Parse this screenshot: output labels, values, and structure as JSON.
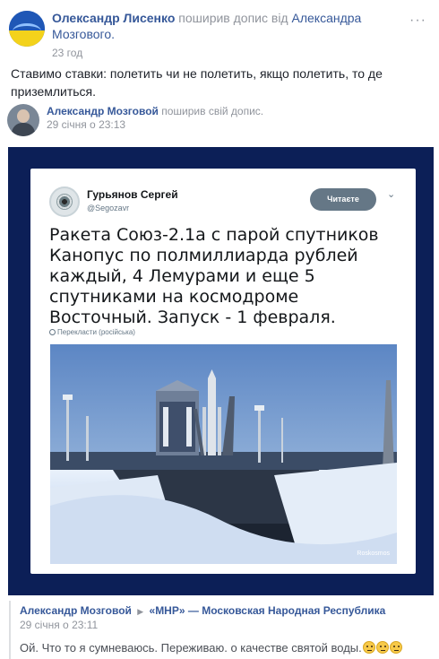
{
  "post": {
    "author": "Олександр Лисенко",
    "shared_text": "поширив допис від",
    "shared_from": "Александра Мозгового",
    "timestamp": "23 год",
    "more": "···",
    "text": "Ставимо ставки: полетить чи не полетить, якщо полетить, то де приземлиться."
  },
  "inner_post": {
    "author": "Александр Мозговой",
    "shared_text": "поширив свій допис.",
    "timestamp": "29 січня о 23:13"
  },
  "tweet": {
    "name": "Гурьянов Сергей",
    "handle": "@Segozavr",
    "follow_label": "Читаєте",
    "caret": "⌄",
    "text": "Ракета Союз-2.1а с парой спутников Канопус по полмиллиарда рублей каждый, 4 Лемурами и еще 5 спутниками на космодроме Восточный. Запуск - 1 февраля.",
    "translate": "Перекласти (російська)",
    "photo_credit": "Roskosmos"
  },
  "comment": {
    "author": "Александр Мозговой",
    "arrow": "▶",
    "group": "«МНР» — Московская Народная Республика",
    "timestamp": "29 січня о 23:11",
    "text": "Ой. Что то я сумневаюсь. Переживаю. о качестве святой воды."
  },
  "colors": {
    "link": "#365899",
    "muted": "#90949c",
    "frame": "#0c1f57"
  }
}
